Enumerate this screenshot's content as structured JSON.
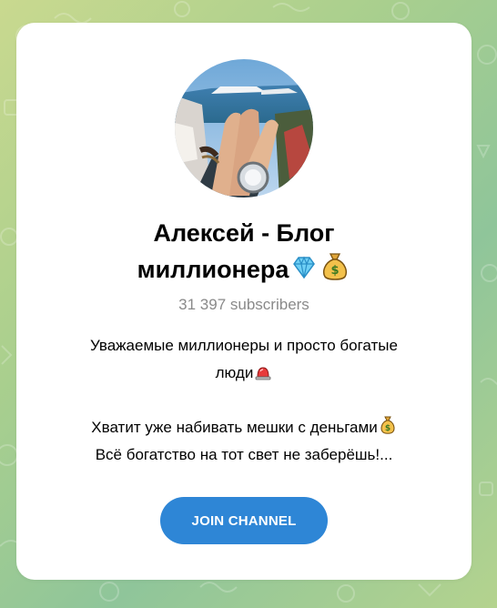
{
  "channel": {
    "title_line1": "Алексей - Блог",
    "title_line2": "миллионера",
    "title_emojis": [
      "gem-icon",
      "money-bag-icon"
    ],
    "subscribers": "31 397 subscribers",
    "description": {
      "line1": "Уважаемые миллионеры и просто богатые",
      "line2": "люди",
      "line3": "Хватит уже набивать мешки с деньгами",
      "line4": "Всё богатство на тот свет не заберёшь!..."
    },
    "avatar_icon": "avatar-photo"
  },
  "actions": {
    "join_label": "JOIN CHANNEL"
  },
  "colors": {
    "button": "#2e86d6",
    "subscribers_text": "#8a8a8a",
    "background": "#a9cf8e"
  }
}
